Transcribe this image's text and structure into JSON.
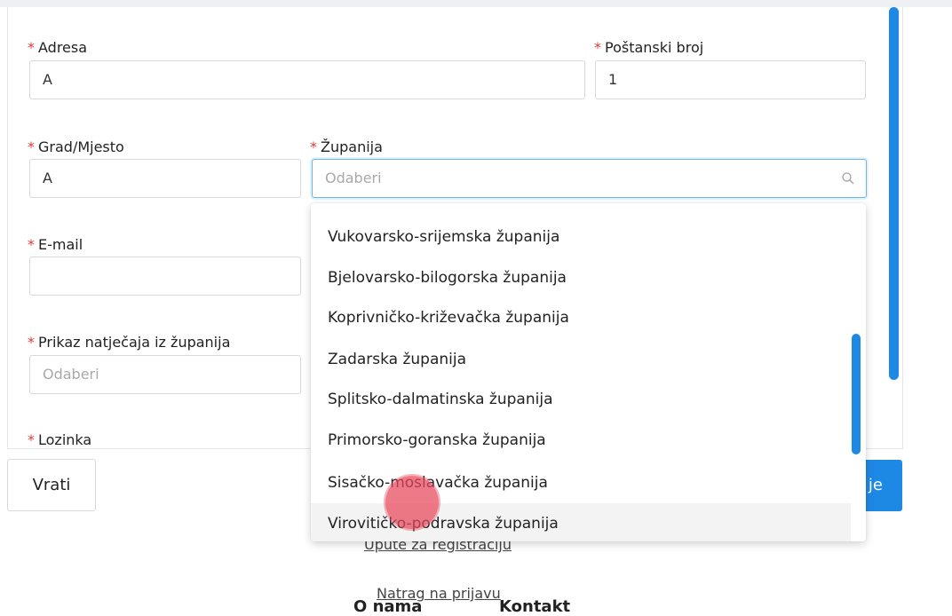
{
  "form": {
    "required_mark": "*",
    "address": {
      "label": "Adresa",
      "value": "A"
    },
    "postal": {
      "label": "Poštanski broj",
      "value": "1"
    },
    "city": {
      "label": "Grad/Mjesto",
      "value": "A"
    },
    "county": {
      "label": "Županija",
      "placeholder": "Odaberi"
    },
    "email": {
      "label": "E-mail",
      "value": ""
    },
    "county_display": {
      "label": "Prikaz natječaja iz županija",
      "placeholder": "Odaberi"
    },
    "password": {
      "label": "Lozinka"
    }
  },
  "dropdown": {
    "options": [
      "Vukovarsko-srijemska županija",
      "Bjelovarsko-bilogorska županija",
      "Koprivničko-križevačka županija",
      "Zadarska županija",
      "Splitsko-dalmatinska županija",
      "Primorsko-goranska županija",
      "Sisačko-moslavačka županija",
      "Virovitičko-podravska županija"
    ],
    "hovered_index": 7
  },
  "actions": {
    "back_label": "Vrati",
    "submit_label_visible": "je"
  },
  "links": {
    "guide": "Upute za registraciju",
    "back_to_login": "Natrag na prijavu"
  },
  "footer": {
    "about": "O nama",
    "contact": "Kontakt"
  },
  "colors": {
    "accent": "#1e88e5",
    "required": "#e03a3a",
    "cursor": "#e8465a"
  }
}
